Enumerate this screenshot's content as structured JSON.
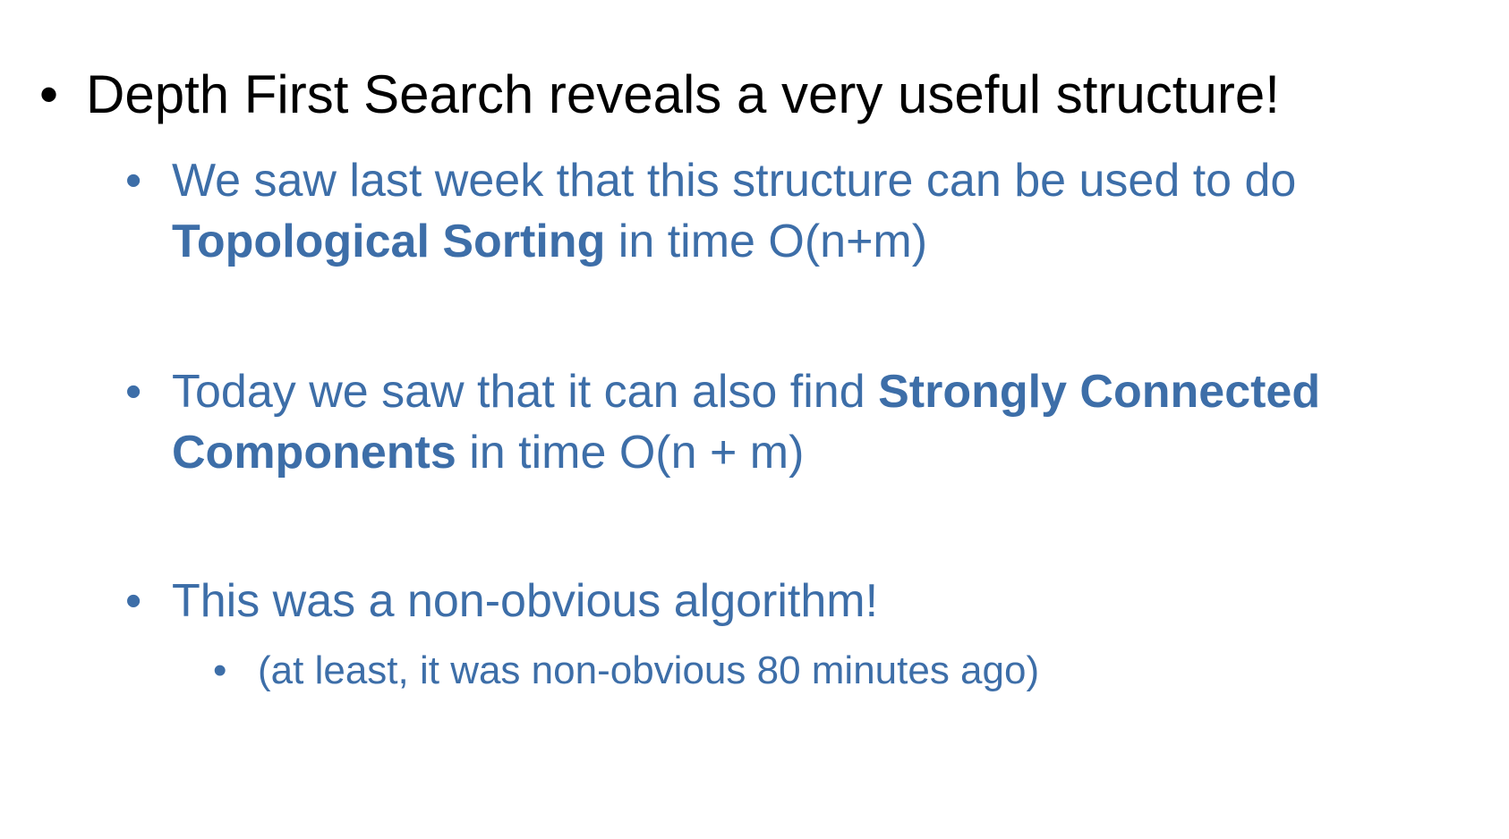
{
  "colors": {
    "primary_text": "#000000",
    "sub_text": "#3D6EA8",
    "background": "#FFFFFF"
  },
  "bullet_glyph": "•",
  "main_point": "Depth First Search reveals a very useful structure!",
  "sub_points": [
    {
      "text_before": "We saw last week that this structure can be used to do ",
      "bold": "Topological Sorting",
      "text_after": " in time O(n+m)"
    },
    {
      "text_before": "Today we saw that it can also find ",
      "bold": "Strongly Connected Components",
      "text_after": " in time O(n + m)"
    },
    {
      "text": "This was a non-obvious algorithm!",
      "sub_sub_points": [
        {
          "text": "(at least, it was non-obvious 80 minutes ago)"
        }
      ]
    }
  ]
}
